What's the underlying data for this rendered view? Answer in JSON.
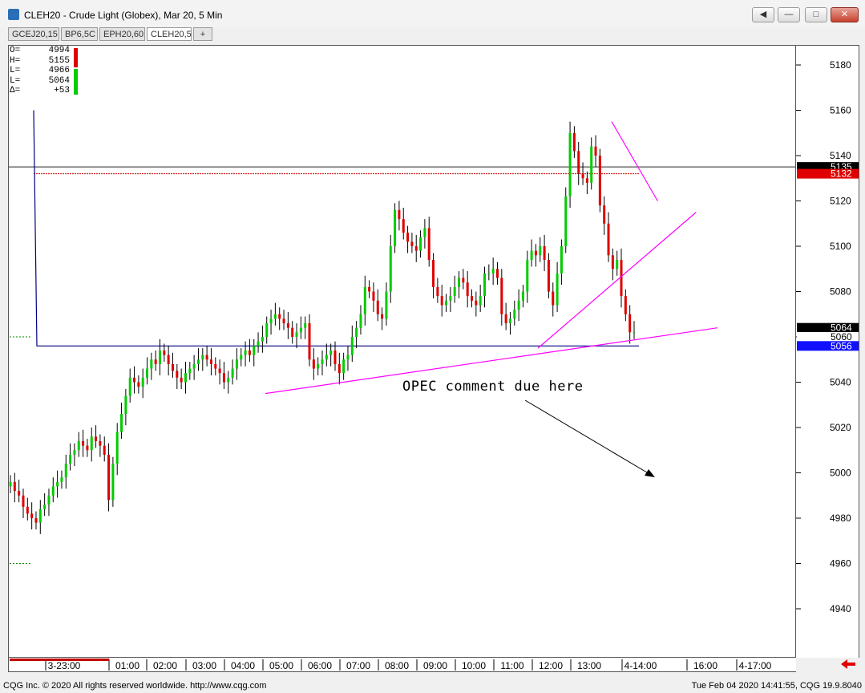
{
  "window": {
    "title": "CLEH20 - Crude Light (Globex), Mar 20, 5 Min",
    "buttons": {
      "extra": "◀",
      "minimize": "—",
      "maximize": "□",
      "close": "✕"
    }
  },
  "tabs": [
    {
      "label": "GCEJ20,15"
    },
    {
      "label": "BP6,5C"
    },
    {
      "label": "EPH20,60"
    },
    {
      "label": "CLEH20,5",
      "active": true
    },
    {
      "label": "+"
    }
  ],
  "ohlc": [
    {
      "key": "O=",
      "value": "4994"
    },
    {
      "key": "H=",
      "value": "5155"
    },
    {
      "key": "L=",
      "value": "4966"
    },
    {
      "key": "L=",
      "value": "5064"
    },
    {
      "key": "Δ=",
      "value": "+53"
    }
  ],
  "annotation": "OPEC comment due here",
  "status": {
    "left": "CQG Inc. © 2020 All rights reserved worldwide. http://www.cqg.com",
    "right": "Tue Feb 04 2020 14:41:55, CQG 19.9.8040"
  },
  "colors": {
    "up": "#00cc00",
    "down": "#dd0000",
    "trendline": "#ff00ff",
    "range_line": "#000080",
    "last_price_bg": "#000000",
    "red_marker_bg": "#e00000",
    "blue_marker_bg": "#1010ff"
  },
  "chart_data": {
    "type": "candlestick",
    "symbol": "CLEH20",
    "interval": "5 Min",
    "y_ticks": [
      5180,
      5160,
      5140,
      5120,
      5100,
      5080,
      5060,
      5040,
      5020,
      5000,
      4980,
      4960,
      4940
    ],
    "x_ticks": [
      "3-23:00",
      "01:00",
      "02:00",
      "03:00",
      "04:00",
      "05:00",
      "06:00",
      "07:00",
      "08:00",
      "09:00",
      "10:00",
      "11:00",
      "12:00",
      "13:00",
      "4-14:00",
      "16:00",
      "4-17:00"
    ],
    "price_markers": [
      {
        "value": 5135,
        "label": "5135",
        "style": "black"
      },
      {
        "value": 5132,
        "label": "5132",
        "style": "red"
      },
      {
        "value": 5064,
        "label": "5064",
        "style": "black"
      },
      {
        "value": 5060,
        "label": "5060",
        "style": "white"
      },
      {
        "value": 5056,
        "label": "5056",
        "style": "blue"
      }
    ],
    "horizontal_lines": [
      {
        "value": 5135,
        "style": "solid-gray"
      },
      {
        "value": 5132,
        "style": "dotted-red"
      },
      {
        "value": 5056,
        "style": "solid-navy"
      }
    ],
    "closes": [
      4996,
      4992,
      4990,
      4985,
      4982,
      4980,
      4978,
      4984,
      4986,
      4990,
      4994,
      4996,
      4998,
      5004,
      5008,
      5010,
      5014,
      5012,
      5010,
      5016,
      5014,
      5012,
      5008,
      4988,
      5004,
      5018,
      5026,
      5034,
      5042,
      5040,
      5038,
      5042,
      5046,
      5050,
      5048,
      5054,
      5052,
      5048,
      5045,
      5042,
      5040,
      5044,
      5046,
      5048,
      5050,
      5052,
      5050,
      5048,
      5046,
      5044,
      5040,
      5042,
      5046,
      5050,
      5052,
      5054,
      5052,
      5056,
      5058,
      5060,
      5066,
      5068,
      5070,
      5068,
      5066,
      5064,
      5060,
      5062,
      5064,
      5066,
      5050,
      5046,
      5048,
      5050,
      5052,
      5054,
      5048,
      5044,
      5050,
      5052,
      5060,
      5064,
      5070,
      5082,
      5080,
      5076,
      5070,
      5068,
      5080,
      5100,
      5116,
      5112,
      5106,
      5102,
      5100,
      5098,
      5104,
      5108,
      5094,
      5082,
      5078,
      5074,
      5076,
      5078,
      5082,
      5086,
      5084,
      5078,
      5076,
      5074,
      5078,
      5088,
      5088,
      5090,
      5086,
      5070,
      5066,
      5068,
      5072,
      5076,
      5080,
      5094,
      5098,
      5096,
      5100,
      5094,
      5080,
      5074,
      5088,
      5100,
      5122,
      5150,
      5142,
      5132,
      5130,
      5128,
      5144,
      5140,
      5118,
      5110,
      5096,
      5090,
      5094,
      5078,
      5070,
      5062,
      5062
    ],
    "trendlines": [
      {
        "from": {
          "time": "04:05",
          "value": 5035
        },
        "to": {
          "time": "4-15:30",
          "value": 5064
        }
      },
      {
        "from": {
          "time": "11:10",
          "value": 5055
        },
        "to": {
          "time": "4-15:05",
          "value": 5115
        }
      },
      {
        "from": {
          "time": "13:05",
          "value": 5155
        },
        "to": {
          "time": "4-14:20",
          "value": 5120
        }
      }
    ]
  }
}
